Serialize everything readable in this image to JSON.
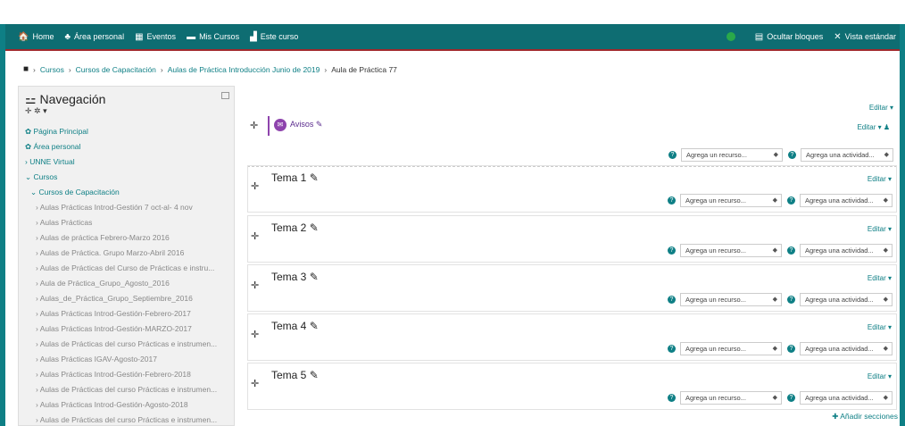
{
  "navbar": {
    "items": [
      {
        "icon": "home-icon",
        "glyph": "🏠",
        "label": "Home"
      },
      {
        "icon": "dashboard-icon",
        "glyph": "♣",
        "label": "Área personal"
      },
      {
        "icon": "calendar-icon",
        "glyph": "▦",
        "label": "Eventos"
      },
      {
        "icon": "briefcase-icon",
        "glyph": "▬",
        "label": "Mis Cursos"
      },
      {
        "icon": "course-icon",
        "glyph": "▟",
        "label": "Este curso"
      }
    ],
    "hide_blocks": "Ocultar bloques",
    "standard_view": "Vista estándar",
    "colors": {
      "bar": "#0e6d72",
      "accent": "#a0282b",
      "status": "#2aa94a"
    }
  },
  "breadcrumb": {
    "items": [
      "Cursos",
      "Cursos de Capacitación",
      "Aulas de Práctica Introducción Junio de 2019"
    ],
    "current": "Aula de Práctica 77",
    "separator": "›"
  },
  "sidebar": {
    "title": "Navegación",
    "controls": "✛ ✲ ▾",
    "items": [
      {
        "label": "Página Principal",
        "prefix": "✿ "
      },
      {
        "label": "Área personal",
        "prefix": "✿ "
      },
      {
        "label": "UNNE Virtual",
        "prefix": "› "
      },
      {
        "label": "Cursos",
        "prefix": "⌄ "
      },
      {
        "label": "Cursos de Capacitación",
        "prefix": "   ⌄ "
      },
      {
        "label": "Aulas Prácticas Introd-Gestión 7 oct-al- 4 nov",
        "prefix": "      › "
      },
      {
        "label": "Aulas Prácticas",
        "prefix": "      › "
      },
      {
        "label": "Aulas de práctica Febrero-Marzo 2016",
        "prefix": "      › "
      },
      {
        "label": "Aulas de Práctica. Grupo Marzo-Abril 2016",
        "prefix": "      › "
      },
      {
        "label": "Aulas de Prácticas del Curso de Prácticas e instru...",
        "prefix": "      › "
      },
      {
        "label": "Aula de Práctica_Grupo_Agosto_2016",
        "prefix": "      › "
      },
      {
        "label": "Aulas_de_Práctica_Grupo_Septiembre_2016",
        "prefix": "      › "
      },
      {
        "label": "Aulas Prácticas Introd-Gestión-Febrero-2017",
        "prefix": "      › "
      },
      {
        "label": "Aulas Prácticas Introd-Gestión-MARZO-2017",
        "prefix": "      › "
      },
      {
        "label": "Aulas de Prácticas del curso Prácticas e instrumen...",
        "prefix": "      › "
      },
      {
        "label": "Aulas Prácticas IGAV-Agosto-2017",
        "prefix": "      › "
      },
      {
        "label": "Aulas Prácticas Introd-Gestión-Febrero-2018",
        "prefix": "      › "
      },
      {
        "label": "Aulas de Prácticas del curso Prácticas e instrumen...",
        "prefix": "      › "
      },
      {
        "label": "Aulas Prácticas Introd-Gestión-Agosto-2018",
        "prefix": "      › "
      },
      {
        "label": "Aulas de Prácticas del curso Prácticas e instrumen...",
        "prefix": "      › "
      }
    ]
  },
  "main": {
    "edit_label": "Editar ▾",
    "avisos": {
      "label": "Avisos",
      "edit": "Editar ▾"
    },
    "resource_placeholder": "Agrega un recurso...",
    "activity_placeholder": "Agrega una actividad...",
    "sections": [
      {
        "title": "Tema 1"
      },
      {
        "title": "Tema 2"
      },
      {
        "title": "Tema 3"
      },
      {
        "title": "Tema 4"
      },
      {
        "title": "Tema 5"
      }
    ],
    "add_sections": "Añadir secciones"
  }
}
